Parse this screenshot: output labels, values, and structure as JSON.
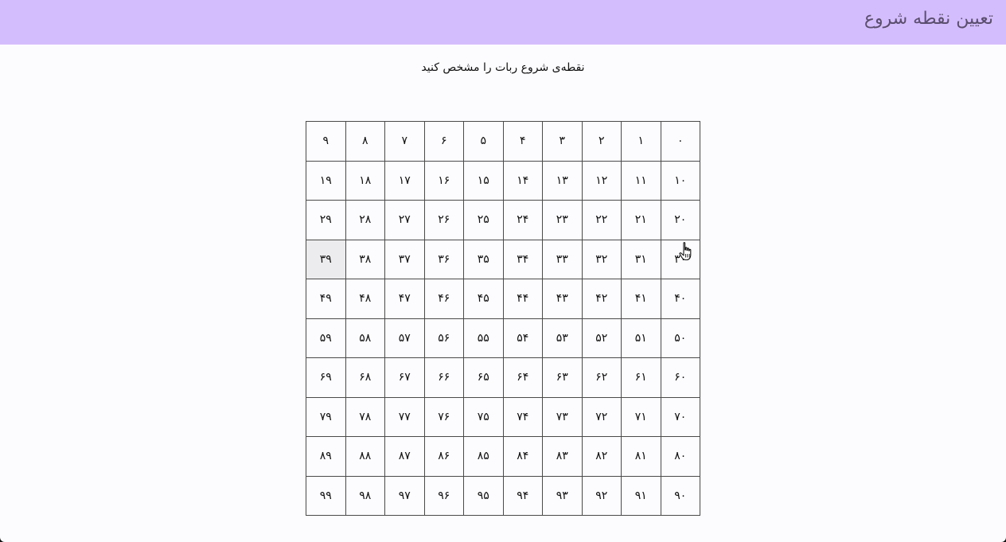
{
  "header": {
    "title": "تعیین نقطه شروع"
  },
  "main": {
    "instruction": "نقطه‌ی شروع ربات را مشخص کنید"
  },
  "grid": {
    "rows": 10,
    "cols": 10,
    "hovered_cell": "۳۹",
    "cells": [
      "۰",
      "۱",
      "۲",
      "۳",
      "۴",
      "۵",
      "۶",
      "۷",
      "۸",
      "۹",
      "۱۰",
      "۱۱",
      "۱۲",
      "۱۳",
      "۱۴",
      "۱۵",
      "۱۶",
      "۱۷",
      "۱۸",
      "۱۹",
      "۲۰",
      "۲۱",
      "۲۲",
      "۲۳",
      "۲۴",
      "۲۵",
      "۲۶",
      "۲۷",
      "۲۸",
      "۲۹",
      "۳۰",
      "۳۱",
      "۳۲",
      "۳۳",
      "۳۴",
      "۳۵",
      "۳۶",
      "۳۷",
      "۳۸",
      "۳۹",
      "۴۰",
      "۴۱",
      "۴۲",
      "۴۳",
      "۴۴",
      "۴۵",
      "۴۶",
      "۴۷",
      "۴۸",
      "۴۹",
      "۵۰",
      "۵۱",
      "۵۲",
      "۵۳",
      "۵۴",
      "۵۵",
      "۵۶",
      "۵۷",
      "۵۸",
      "۵۹",
      "۶۰",
      "۶۱",
      "۶۲",
      "۶۳",
      "۶۴",
      "۶۵",
      "۶۶",
      "۶۷",
      "۶۸",
      "۶۹",
      "۷۰",
      "۷۱",
      "۷۲",
      "۷۳",
      "۷۴",
      "۷۵",
      "۷۶",
      "۷۷",
      "۷۸",
      "۷۹",
      "۸۰",
      "۸۱",
      "۸۲",
      "۸۳",
      "۸۴",
      "۸۵",
      "۸۶",
      "۸۷",
      "۸۸",
      "۸۹",
      "۹۰",
      "۹۱",
      "۹۲",
      "۹۳",
      "۹۴",
      "۹۵",
      "۹۶",
      "۹۷",
      "۹۸",
      "۹۹"
    ]
  },
  "colors": {
    "header_bg": "#d4bdfd",
    "title_text": "#5a4e6e",
    "page_bg": "#fcfbfe",
    "grid_line": "#4a4a4a",
    "hover_bg": "#ececee"
  },
  "cursor": {
    "icon": "hand-pointer-icon"
  }
}
